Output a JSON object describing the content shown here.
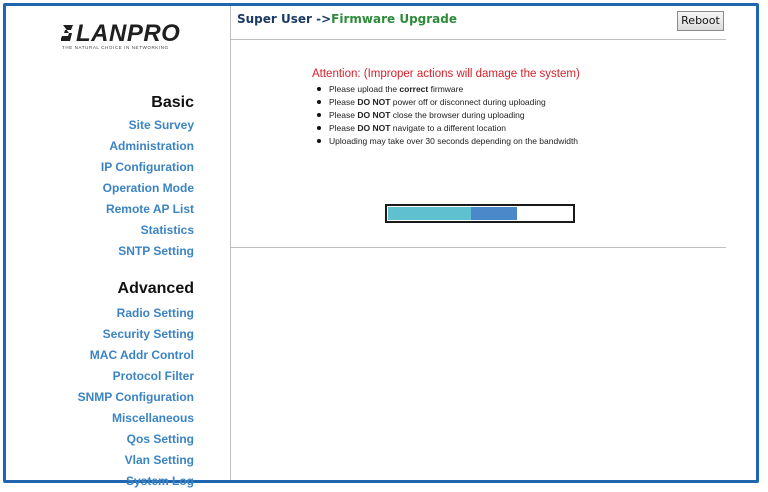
{
  "logo": {
    "name": "LANPRO",
    "tagline": "THE NATURAL CHOICE IN NETWORKING"
  },
  "sidebar": {
    "basic_heading": "Basic",
    "basic_items": [
      {
        "label": "Site Survey"
      },
      {
        "label": "Administration"
      },
      {
        "label": "IP Configuration"
      },
      {
        "label": "Operation Mode"
      },
      {
        "label": "Remote AP List"
      },
      {
        "label": "Statistics"
      },
      {
        "label": "SNTP Setting"
      }
    ],
    "advanced_heading": "Advanced",
    "advanced_items": [
      {
        "label": "Radio Setting"
      },
      {
        "label": "Security Setting"
      },
      {
        "label": "MAC Addr Control"
      },
      {
        "label": "Protocol Filter"
      },
      {
        "label": "SNMP Configuration"
      },
      {
        "label": "Miscellaneous"
      },
      {
        "label": "Qos Setting"
      },
      {
        "label": "Vlan Setting"
      },
      {
        "label": "System Log"
      }
    ]
  },
  "header": {
    "crumb_prefix": "Super User ->",
    "crumb_current": "Firmware Upgrade",
    "reboot_label": "Reboot"
  },
  "main": {
    "attention": "Attention: (Improper actions will damage the system)",
    "bullets": [
      {
        "pre": "Please upload the ",
        "bold": "correct",
        "post": " firmware"
      },
      {
        "pre": "Please ",
        "bold": "DO NOT",
        "post": " power off or disconnect during uploading"
      },
      {
        "pre": "Please ",
        "bold": "DO NOT",
        "post": " close the browser during uploading"
      },
      {
        "pre": "Please ",
        "bold": "DO NOT",
        "post": " navigate to a different location"
      },
      {
        "pre": "Uploading may take over 30 seconds depending on the bandwidth",
        "bold": "",
        "post": ""
      }
    ],
    "progress": {
      "fraction": 0.7,
      "segments": [
        0.45,
        0.25
      ],
      "colors": [
        "#5fc0cf",
        "#4b88c9"
      ]
    }
  },
  "colors": {
    "frame": "#1f66b1",
    "nav_link": "#3b84c4",
    "attention": "#d8202a",
    "crumb_current": "#2e8b3a"
  }
}
